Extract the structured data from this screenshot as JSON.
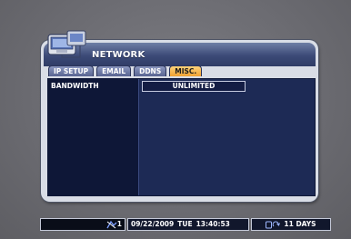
{
  "dialog": {
    "title": "NETWORK",
    "tabs": [
      {
        "label": "IP SETUP"
      },
      {
        "label": "EMAIL"
      },
      {
        "label": "DDNS"
      },
      {
        "label": "MISC."
      }
    ],
    "active_tab": "MISC."
  },
  "settings": {
    "bandwidth_label": "BANDWIDTH",
    "bandwidth_value": "UNLIMITED"
  },
  "statusbar": {
    "channel_number": "1",
    "date": "09/22/2009",
    "weekday": "TUE",
    "time": "13:40:53",
    "storage": "11 DAYS"
  },
  "colors": {
    "titlebar": "#3c4a77",
    "active_tab": "#f0a133",
    "panel_bg": "#1d2a55"
  },
  "icons": {
    "title": "network-icon",
    "status_channel": "network-channel-icon",
    "status_storage": "hdd-cycle-icon"
  }
}
